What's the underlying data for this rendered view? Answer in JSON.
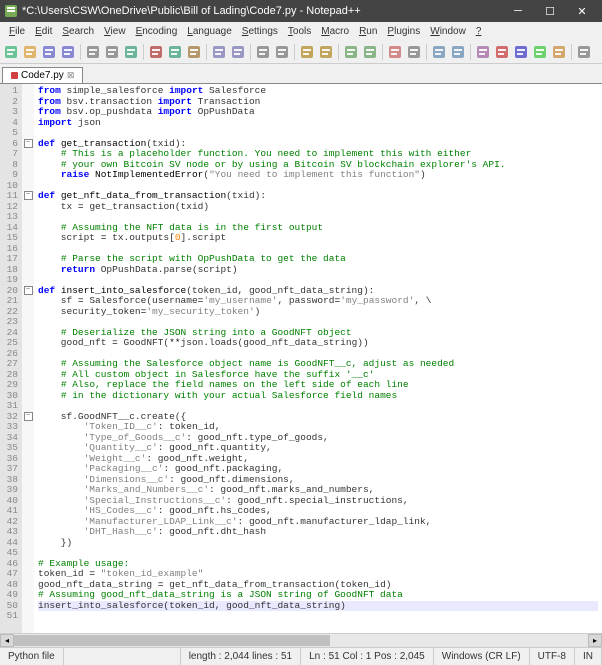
{
  "window": {
    "title": "*C:\\Users\\CSW\\OneDrive\\Public\\Bill of Lading\\Code7.py - Notepad++"
  },
  "menus": [
    "File",
    "Edit",
    "Search",
    "View",
    "Encoding",
    "Language",
    "Settings",
    "Tools",
    "Macro",
    "Run",
    "Plugins",
    "Window",
    "?"
  ],
  "tab": {
    "label": "Code7.py"
  },
  "status": {
    "lang": "Python file",
    "length": "length : 2,044   lines : 51",
    "pos": "Ln : 51   Col : 1   Pos : 2,045",
    "eol": "Windows (CR LF)",
    "enc": "UTF-8",
    "ins": "IN"
  },
  "code": [
    {
      "n": 1,
      "h": "<span class='kw'>from</span> simple_salesforce <span class='kw'>import</span> Salesforce"
    },
    {
      "n": 2,
      "h": "<span class='kw'>from</span> bsv.transaction <span class='kw'>import</span> Transaction"
    },
    {
      "n": 3,
      "h": "<span class='kw'>from</span> bsv.op_pushdata <span class='kw'>import</span> OpPushData"
    },
    {
      "n": 4,
      "h": "<span class='kw'>import</span> json"
    },
    {
      "n": 5,
      "h": ""
    },
    {
      "n": 6,
      "fold": true,
      "h": "<span class='kw'>def</span> <span class='def'>get_transaction</span>(txid):"
    },
    {
      "n": 7,
      "h": "    <span class='cm'># This is a placeholder function. You need to implement this with either</span>"
    },
    {
      "n": 8,
      "h": "    <span class='cm'># your own Bitcoin SV node or by using a Bitcoin SV blockchain explorer's API.</span>"
    },
    {
      "n": 9,
      "h": "    <span class='kw'>raise</span> <span class='fn'>NotImplementedError</span>(<span class='str'>\"You need to implement this function\"</span>)"
    },
    {
      "n": 10,
      "h": ""
    },
    {
      "n": 11,
      "fold": true,
      "h": "<span class='kw'>def</span> <span class='def'>get_nft_data_from_transaction</span>(txid):"
    },
    {
      "n": 12,
      "h": "    tx <span class='op'>=</span> get_transaction(txid)"
    },
    {
      "n": 13,
      "h": ""
    },
    {
      "n": 14,
      "h": "    <span class='cm'># Assuming the NFT data is in the first output</span>"
    },
    {
      "n": 15,
      "h": "    script <span class='op'>=</span> tx.outputs[<span class='num'>0</span>].script"
    },
    {
      "n": 16,
      "h": ""
    },
    {
      "n": 17,
      "h": "    <span class='cm'># Parse the script with OpPushData to get the data</span>"
    },
    {
      "n": 18,
      "h": "    <span class='kw'>return</span> OpPushData.parse(script)"
    },
    {
      "n": 19,
      "h": ""
    },
    {
      "n": 20,
      "fold": true,
      "h": "<span class='kw'>def</span> <span class='def'>insert_into_salesforce</span>(token_id, good_nft_data_string):"
    },
    {
      "n": 21,
      "h": "    sf <span class='op'>=</span> Salesforce(username<span class='op'>=</span><span class='str'>'my_username'</span>, password<span class='op'>=</span><span class='str'>'my_password'</span>, \\"
    },
    {
      "n": 22,
      "h": "    security_token<span class='op'>=</span><span class='str'>'my_security_token'</span>)"
    },
    {
      "n": 23,
      "h": ""
    },
    {
      "n": 24,
      "h": "    <span class='cm'># Deserialize the JSON string into a GoodNFT object</span>"
    },
    {
      "n": 25,
      "h": "    good_nft <span class='op'>=</span> GoodNFT(<span class='op'>**</span>json.loads(good_nft_data_string))"
    },
    {
      "n": 26,
      "h": ""
    },
    {
      "n": 27,
      "h": "    <span class='cm'># Assuming the Salesforce object name is GoodNFT__c, adjust as needed</span>"
    },
    {
      "n": 28,
      "h": "    <span class='cm'># All custom object in Salesforce have the suffix '__c'</span>"
    },
    {
      "n": 29,
      "h": "    <span class='cm'># Also, replace the field names on the left side of each line</span>"
    },
    {
      "n": 30,
      "h": "    <span class='cm'># in the dictionary with your actual Salesforce field names</span>"
    },
    {
      "n": 31,
      "h": ""
    },
    {
      "n": 32,
      "fold": true,
      "h": "    sf.GoodNFT__c.create({"
    },
    {
      "n": 33,
      "h": "        <span class='str'>'Token_ID__c'</span>: token_id,"
    },
    {
      "n": 34,
      "h": "        <span class='str'>'Type_of_Goods__c'</span>: good_nft.type_of_goods,"
    },
    {
      "n": 35,
      "h": "        <span class='str'>'Quantity__c'</span>: good_nft.quantity,"
    },
    {
      "n": 36,
      "h": "        <span class='str'>'Weight__c'</span>: good_nft.weight,"
    },
    {
      "n": 37,
      "h": "        <span class='str'>'Packaging__c'</span>: good_nft.packaging,"
    },
    {
      "n": 38,
      "h": "        <span class='str'>'Dimensions__c'</span>: good_nft.dimensions,"
    },
    {
      "n": 39,
      "h": "        <span class='str'>'Marks_and_Numbers__c'</span>: good_nft.marks_and_numbers,"
    },
    {
      "n": 40,
      "h": "        <span class='str'>'Special_Instructions__c'</span>: good_nft.special_instructions,"
    },
    {
      "n": 41,
      "h": "        <span class='str'>'HS_Codes__c'</span>: good_nft.hs_codes,"
    },
    {
      "n": 42,
      "h": "        <span class='str'>'Manufacturer_LDAP_Link__c'</span>: good_nft.manufacturer_ldap_link,"
    },
    {
      "n": 43,
      "h": "        <span class='str'>'DHT_Hash__c'</span>: good_nft.dht_hash"
    },
    {
      "n": 44,
      "h": "    })"
    },
    {
      "n": 45,
      "h": ""
    },
    {
      "n": 46,
      "h": "<span class='cm'># Example usage:</span>"
    },
    {
      "n": 47,
      "h": "token_id <span class='op'>=</span> <span class='str'>\"token_id_example\"</span>"
    },
    {
      "n": 48,
      "h": "good_nft_data_string <span class='op'>=</span> get_nft_data_from_transaction(token_id)"
    },
    {
      "n": 49,
      "h": "<span class='cm'># Assuming good_nft_data_string is a JSON string of GoodNFT data</span>"
    },
    {
      "n": 50,
      "hl": true,
      "h": "insert_into_salesforce(token_id, good_nft_data_string)"
    },
    {
      "n": 51,
      "h": ""
    }
  ],
  "toolbar_icons": [
    {
      "c": "#5b8",
      "t": "new"
    },
    {
      "c": "#da5",
      "t": "open"
    },
    {
      "c": "#77c",
      "t": "save"
    },
    {
      "c": "#77c",
      "t": "saveall"
    },
    {
      "sep": true
    },
    {
      "c": "#888",
      "t": "close"
    },
    {
      "c": "#888",
      "t": "closeall"
    },
    {
      "c": "#5a8",
      "t": "print"
    },
    {
      "sep": true
    },
    {
      "c": "#b55",
      "t": "cut"
    },
    {
      "c": "#5a8",
      "t": "copy"
    },
    {
      "c": "#a85",
      "t": "paste"
    },
    {
      "sep": true
    },
    {
      "c": "#88b",
      "t": "undo"
    },
    {
      "c": "#88b",
      "t": "redo"
    },
    {
      "sep": true
    },
    {
      "c": "#888",
      "t": "find"
    },
    {
      "c": "#888",
      "t": "replace"
    },
    {
      "sep": true
    },
    {
      "c": "#b94",
      "t": "zoomin"
    },
    {
      "c": "#b94",
      "t": "zoomout"
    },
    {
      "sep": true
    },
    {
      "c": "#7a7",
      "t": "sync"
    },
    {
      "c": "#7a7",
      "t": "wrap"
    },
    {
      "sep": true
    },
    {
      "c": "#c77",
      "t": "showall"
    },
    {
      "c": "#888",
      "t": "indent"
    },
    {
      "sep": true
    },
    {
      "c": "#79b",
      "t": "fold"
    },
    {
      "c": "#79b",
      "t": "unfold"
    },
    {
      "sep": true
    },
    {
      "c": "#a7a",
      "t": "lang"
    },
    {
      "c": "#c55",
      "t": "rec"
    },
    {
      "c": "#55c",
      "t": "play"
    },
    {
      "c": "#5c5",
      "t": "playm"
    },
    {
      "c": "#c95",
      "t": "save2"
    },
    {
      "sep": true
    },
    {
      "c": "#888",
      "t": "x"
    }
  ]
}
